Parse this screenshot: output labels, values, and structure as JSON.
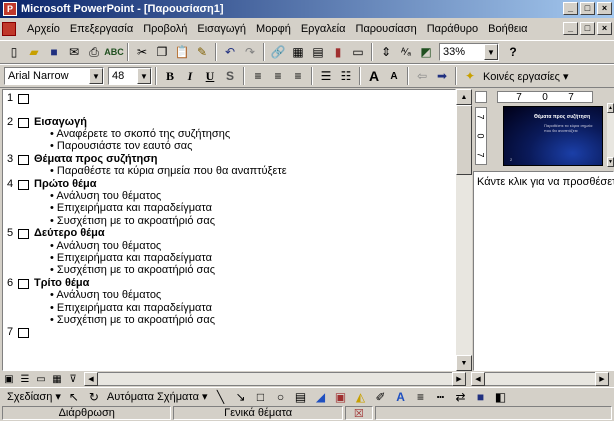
{
  "window": {
    "title": "Microsoft PowerPoint - [Παρουσίαση1]",
    "minimize": "_",
    "restore": "□",
    "close": "×"
  },
  "menu": {
    "items": [
      "Αρχείο",
      "Επεξεργασία",
      "Προβολή",
      "Εισαγωγή",
      "Μορφή",
      "Εργαλεία",
      "Παρουσίαση",
      "Παράθυρο",
      "Βοήθεια"
    ]
  },
  "toolbar": {
    "zoom": "33%",
    "help_glyph": "?"
  },
  "format_toolbar": {
    "font": "Arial Narrow",
    "size": "48",
    "bold": "B",
    "italic": "I",
    "underline": "U",
    "shadow": "S",
    "increase_font": "A",
    "decrease_font": "A",
    "tasks": "Κοινές εργασίες ▾"
  },
  "outline": {
    "slides": [
      {
        "num": "1",
        "title": "",
        "bullets": []
      },
      {
        "num": "2",
        "title": "Εισαγωγή",
        "bullets": [
          "Αναφέρετε το σκοπό της συζήτησης",
          "Παρουσιάστε τον εαυτό σας"
        ]
      },
      {
        "num": "3",
        "title": "Θέματα προς συζήτηση",
        "bullets": [
          "Παραθέστε τα κύρια σημεία που θα αναπτύξετε"
        ]
      },
      {
        "num": "4",
        "title": "Πρώτο θέμα",
        "bullets": [
          "Ανάλυση του θέματος",
          "Επιχειρήματα και παραδείγματα",
          "Συσχέτιση με το ακροατήριό σας"
        ]
      },
      {
        "num": "5",
        "title": "Δεύτερο θέμα",
        "bullets": [
          "Ανάλυση του θέματος",
          "Επιχειρήματα και παραδείγματα",
          "Συσχέτιση με το ακροατήριό σας"
        ]
      },
      {
        "num": "6",
        "title": "Τρίτο θέμα",
        "bullets": [
          "Ανάλυση του θέματος",
          "Επιχειρήματα και παραδείγματα",
          "Συσχέτιση με το ακροατήριό σας"
        ]
      },
      {
        "num": "7",
        "title": "",
        "bullets": []
      }
    ]
  },
  "slide_preview": {
    "ruler_h": [
      "7",
      "0",
      "7"
    ],
    "ruler_v": [
      "7",
      "0",
      "7"
    ],
    "thumb_title": "Θέματα προς συζήτηση",
    "thumb_sub": "Παραθέστε τα κύρια σημεία που θα αναπτύξετε",
    "thumb_foot": "2"
  },
  "notes": {
    "placeholder": "Κάντε κλικ για να προσθέσετε"
  },
  "drawing": {
    "draw_menu": "Σχεδίαση ▾",
    "autoshapes": "Αυτόματα Σχήματα ▾"
  },
  "status": {
    "view": "Διάρθρωση",
    "template": "Γενικά θέματα"
  }
}
